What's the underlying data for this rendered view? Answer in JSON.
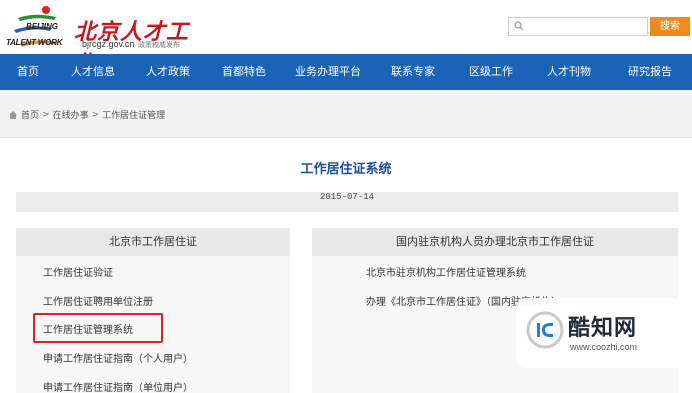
{
  "header": {
    "logo_en_line1": "BEIJING",
    "logo_en_line2": "TALENT WORK",
    "logo_cn": "北京人才工作",
    "logo_url": "bjrcgz.gov.cn",
    "logo_slogan": "政策权威发布",
    "search_placeholder": "",
    "search_button": "搜索"
  },
  "nav": {
    "items": [
      "首页",
      "人才信息",
      "人才政策",
      "首都特色",
      "业务办理平台",
      "联系专家",
      "区级工作",
      "人才刊物",
      "研究报告"
    ]
  },
  "breadcrumb": {
    "home": "首页",
    "level1": "在线办事",
    "level2": "工作居住证管理"
  },
  "main": {
    "title": "工作居住证系统",
    "date": "2015-07-14"
  },
  "left_panel": {
    "title": "北京市工作居住证",
    "links": [
      "工作居住证验证",
      "工作居住证聘用单位注册",
      "工作居住证管理系统",
      "申请工作居住证指南（个人用户）",
      "申请工作居住证指南（单位用户）"
    ]
  },
  "right_panel": {
    "title": "国内驻京机构人员办理北京市工作居住证",
    "links": [
      "北京市驻京机构工作居住证管理系统",
      "办理《北京市工作居住证》（国内驻京机构）"
    ]
  },
  "watermark": {
    "name": "酷知网",
    "url": "www.coozhi.com"
  },
  "colors": {
    "nav_bg": "#1b63b7",
    "search_button": "#f08a1d",
    "title": "#1b4f9a",
    "highlight": "#d9241c",
    "logo_red": "#c8161d"
  }
}
